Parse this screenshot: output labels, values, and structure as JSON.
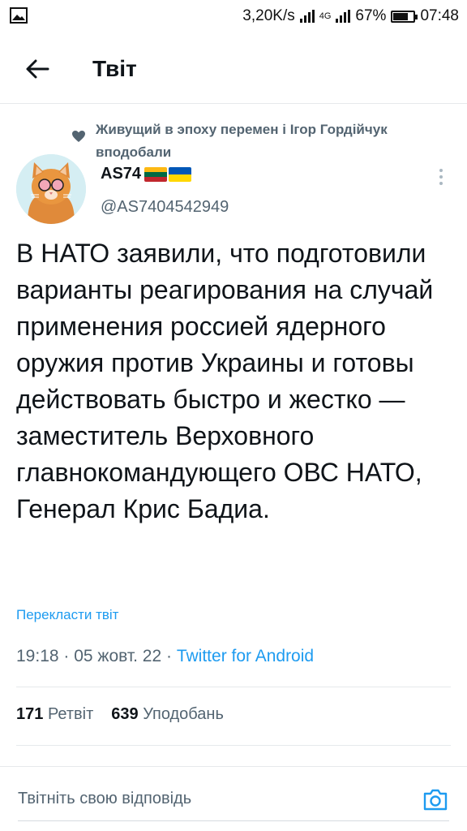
{
  "status_bar": {
    "net_speed": "3,20K/s",
    "network": "4G",
    "battery": "67%",
    "battery_level": 0.67,
    "time": "07:48"
  },
  "header": {
    "title": "Твіт",
    "back_icon": "arrow-left-icon"
  },
  "social_context": {
    "text": "Живущий в эпоху перемен і Ігор Гордійчук вподобали",
    "icon": "heart-icon"
  },
  "author": {
    "name": "AS74",
    "handle": "@AS7404542949",
    "flags": [
      "lithuania-flag-icon",
      "ukraine-flag-icon"
    ]
  },
  "tweet": {
    "text": "В НАТО заявили, что подготовили варианты реагирования на случай применения россией ядерного оружия против Украины и готовы действовать быстро и жестко — заместитель Верховного главнокомандующего ОВС НАТО, Генерал Крис Бадиа.",
    "translate_label": "Перекласти твіт",
    "time": "19:18",
    "date": "05 жовт. 22",
    "source": "Twitter for Android"
  },
  "stats": {
    "retweets_count": "171",
    "retweets_label": "Ретвіт",
    "likes_count": "639",
    "likes_label": "Уподобань"
  },
  "reply": {
    "placeholder": "Твітніть свою відповідь",
    "camera_icon": "camera-icon"
  },
  "colors": {
    "accent": "#1d9bf0",
    "secondary_text": "#536471",
    "divider": "#e6e9ec"
  }
}
